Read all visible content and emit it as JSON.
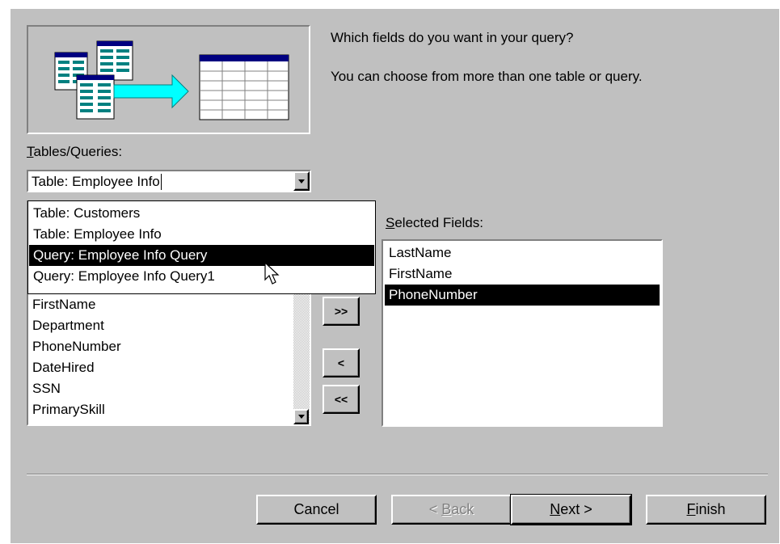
{
  "wizard": {
    "question": "Which fields do you want in your query?",
    "hint": "You can choose from more than one table or query.",
    "tables_label_hotkey": "T",
    "tables_label_rest": "ables/Queries:",
    "selected_label_hotkey": "S",
    "selected_label_rest": "elected Fields:"
  },
  "combo": {
    "value": "Table: Employee Info",
    "options": [
      {
        "label": "Table: Customers"
      },
      {
        "label": "Table: Employee Info"
      },
      {
        "label": "Query: Employee Info Query",
        "highlighted": true
      },
      {
        "label": "Query: Employee Info Query1"
      }
    ]
  },
  "available_fields": [
    "FirstName",
    "Department",
    "PhoneNumber",
    "DateHired",
    "SSN",
    "PrimarySkill"
  ],
  "selected_fields": [
    {
      "label": "LastName"
    },
    {
      "label": "FirstName"
    },
    {
      "label": "PhoneNumber",
      "selected": true
    }
  ],
  "move_buttons": {
    "add_all": ">>",
    "remove": "<",
    "remove_all": "<<"
  },
  "footer": {
    "cancel": "Cancel",
    "back_pre": "< ",
    "back_hotkey": "B",
    "back_rest": "ack",
    "next_hotkey": "N",
    "next_rest": "ext >",
    "finish_hotkey": "F",
    "finish_rest": "inish"
  },
  "colors": {
    "dialog": "#c0c0c0",
    "selection": "#000000",
    "arrow_accent": "#00ffff",
    "table_header": "#000080"
  }
}
